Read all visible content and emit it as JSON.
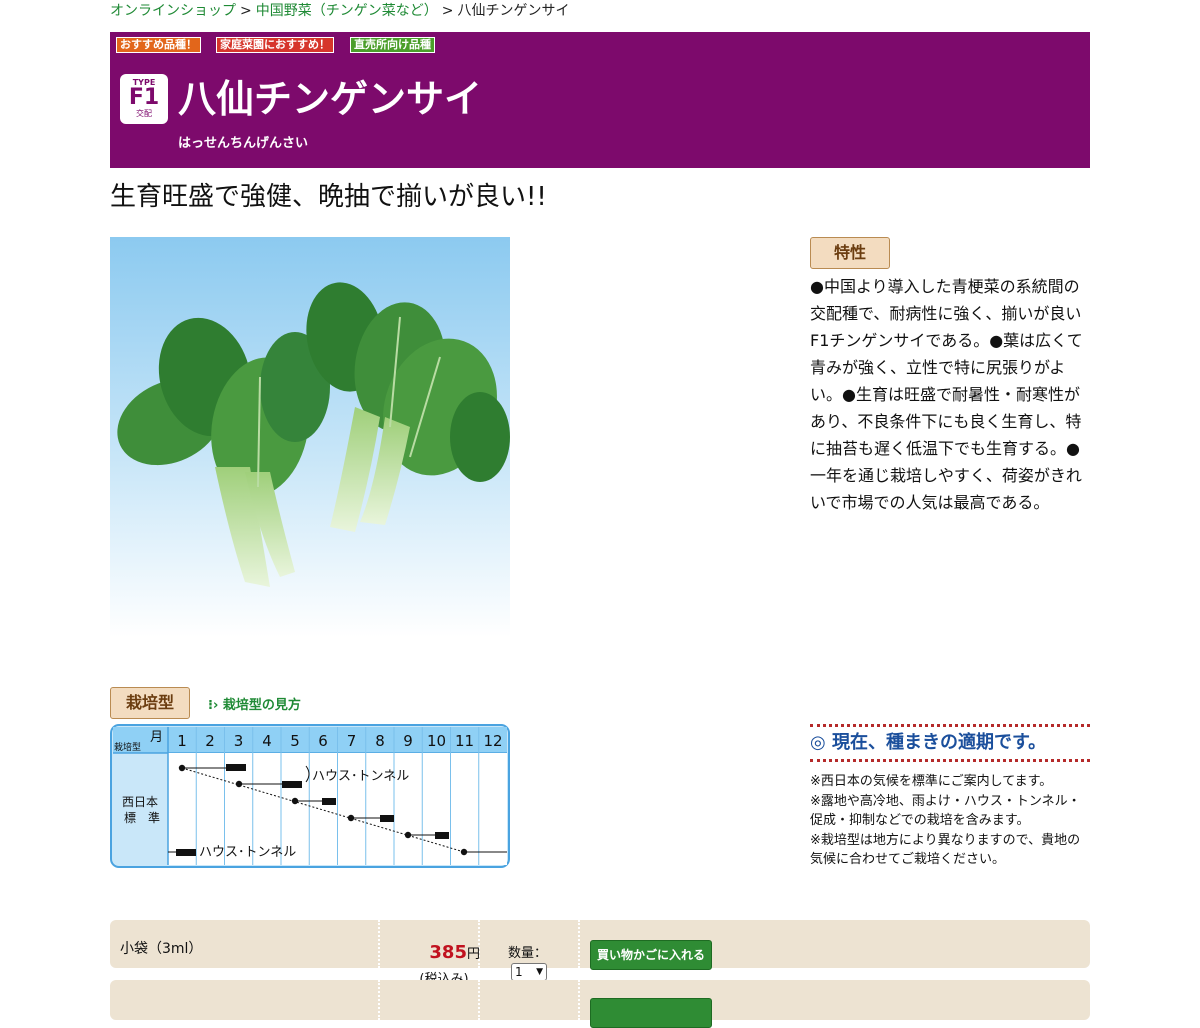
{
  "breadcrumb": {
    "home": "オンラインショップ",
    "category": "中国野菜（チンゲン菜など）",
    "current": "八仙チンゲンサイ",
    "separator": ">"
  },
  "hero": {
    "background": "#7d0a6c",
    "badges": [
      {
        "label": "おすすめ品種！",
        "color": "#e2661b"
      },
      {
        "label": "家庭菜園におすすめ！",
        "color": "#d6352b"
      },
      {
        "label": "直売所向け品種",
        "color": "#4b9e2a"
      }
    ],
    "type_top": "TYPE",
    "type_main": "F1",
    "type_bottom": "交配",
    "title": "八仙チンゲンサイ",
    "kana": "はっせんちんげんさい"
  },
  "catchcopy": "生育旺盛で強健、晩抽で揃いが良い!!",
  "features": {
    "tag": "特性",
    "text": "●中国より導入した青梗菜の系統間の交配種で、耐病性に強く、揃いが良いF1チンゲンサイである。●葉は広くて青みが強く、立性で特に尻張りがよい。●生育は旺盛で耐暑性・耐寒性があり、不良条件下にも良く生育し、特に抽苔も遅く低温下でも生育する。●一年を通じ栽培しやすく、荷姿がきれいで市場での人気は最高である。"
  },
  "cultivation": {
    "tag": "栽培型",
    "guide_link": "栽培型の見方",
    "month_label": "月",
    "type_label": "栽培型",
    "region_label_1": "西日本",
    "region_label_2": "標　準",
    "months": [
      "1",
      "2",
      "3",
      "4",
      "5",
      "6",
      "7",
      "8",
      "9",
      "10",
      "11",
      "12"
    ],
    "note_house_1": "ハウス･トンネル",
    "note_house_2": "ハウス･トンネル"
  },
  "sowing": {
    "title": "◎ 現在、種まきの適期です。",
    "notes": [
      "※西日本の気候を標準にご案内してます。",
      "※露地や高冷地、雨よけ・ハウス・トンネル・促成・抑制などでの栽培を含みます。",
      "※栽培型は地方により異なりますので、貴地の気候に合わせてご栽培ください。"
    ]
  },
  "order": {
    "item_name": "小袋（3ml）",
    "price": "385",
    "yen": "円",
    "tax": "(税込み)",
    "qty_label": "数量：",
    "qty_value": "1",
    "cart_button": "買い物かごに入れる"
  }
}
